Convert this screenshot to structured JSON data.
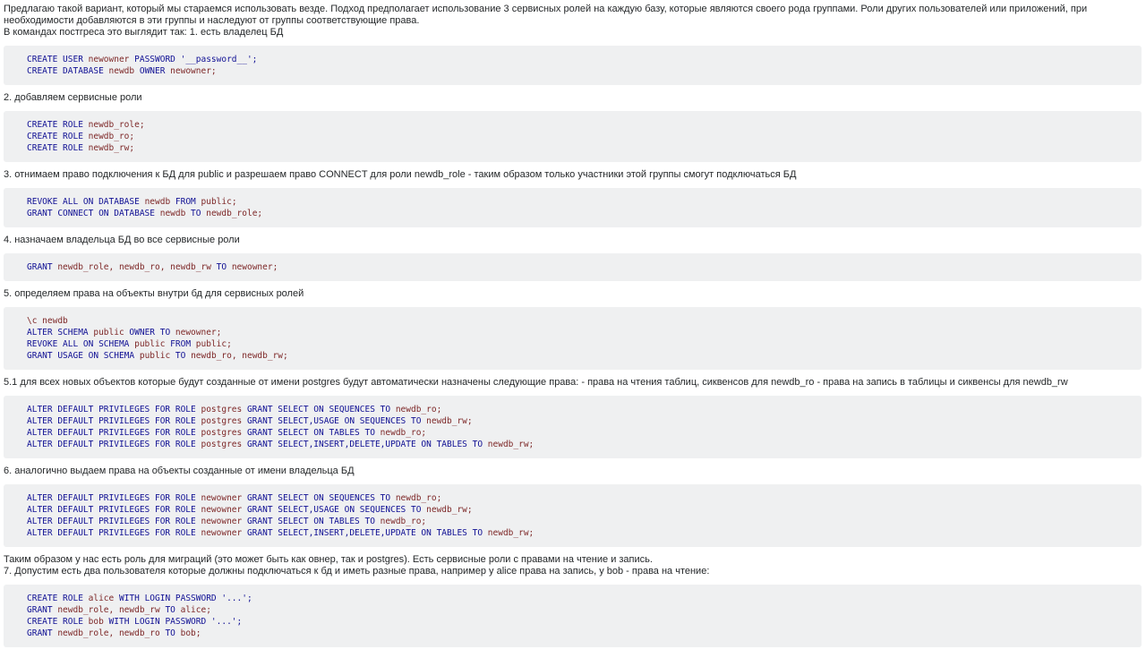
{
  "colors": {
    "page_bg": "#ffffff",
    "text": "#242729",
    "code_bg": "#eff0f1",
    "keyword": "#101094",
    "identifier": "#7d2727",
    "string": "#101094"
  },
  "content": {
    "blocks": [
      {
        "type": "p",
        "text": "Предлагаю такой вариант, который мы стараемся использовать везде. Подход предполагает использование 3 сервисных ролей на каждую базу, которые являются своего рода группами. Роли других пользователей или приложений, при необходимости добавляются в эти группы и наследуют от группы соответствующие права."
      },
      {
        "type": "p",
        "text": "В командах постгреса это выглядит так: 1. есть владелец БД"
      },
      {
        "type": "code",
        "lines": [
          [
            [
              "k",
              "CREATE USER "
            ],
            [
              "i",
              "newowner "
            ],
            [
              "k",
              "PASSWORD "
            ],
            [
              "s",
              "'__password__';"
            ]
          ],
          [
            [
              "k",
              "CREATE DATABASE "
            ],
            [
              "i",
              "newdb "
            ],
            [
              "k",
              "OWNER "
            ],
            [
              "i",
              "newowner;"
            ]
          ]
        ]
      },
      {
        "type": "p",
        "text": "2. добавляем сервисные роли"
      },
      {
        "type": "code",
        "lines": [
          [
            [
              "k",
              "CREATE ROLE "
            ],
            [
              "i",
              "newdb_role;"
            ]
          ],
          [
            [
              "k",
              "CREATE ROLE "
            ],
            [
              "i",
              "newdb_ro;"
            ]
          ],
          [
            [
              "k",
              "CREATE ROLE "
            ],
            [
              "i",
              "newdb_rw;"
            ]
          ]
        ]
      },
      {
        "type": "p",
        "text": "3. отнимаем право подключения к БД для public и разрешаем право CONNECT для роли newdb_role - таким образом только участники этой группы смогут подключаться БД"
      },
      {
        "type": "code",
        "lines": [
          [
            [
              "k",
              "REVOKE ALL ON DATABASE "
            ],
            [
              "i",
              "newdb "
            ],
            [
              "k",
              "FROM "
            ],
            [
              "i",
              "public;"
            ]
          ],
          [
            [
              "k",
              "GRANT CONNECT ON DATABASE "
            ],
            [
              "i",
              "newdb "
            ],
            [
              "k",
              "TO "
            ],
            [
              "i",
              "newdb_role;"
            ]
          ]
        ]
      },
      {
        "type": "p",
        "text": "4. назначаем владельца БД во все сервисные роли"
      },
      {
        "type": "code",
        "lines": [
          [
            [
              "k",
              "GRANT "
            ],
            [
              "i",
              "newdb_role, newdb_ro, newdb_rw "
            ],
            [
              "k",
              "TO "
            ],
            [
              "i",
              "newowner;"
            ]
          ]
        ]
      },
      {
        "type": "p",
        "text": "5. определяем права на объекты внутри бд для сервисных ролей"
      },
      {
        "type": "code",
        "lines": [
          [
            [
              "i",
              "\\c newdb"
            ]
          ],
          [
            [
              "k",
              "ALTER SCHEMA "
            ],
            [
              "i",
              "public "
            ],
            [
              "k",
              "OWNER TO "
            ],
            [
              "i",
              "newowner;"
            ]
          ],
          [
            [
              "k",
              "REVOKE ALL ON SCHEMA "
            ],
            [
              "i",
              "public "
            ],
            [
              "k",
              "FROM "
            ],
            [
              "i",
              "public;"
            ]
          ],
          [
            [
              "k",
              "GRANT USAGE ON SCHEMA "
            ],
            [
              "i",
              "public "
            ],
            [
              "k",
              "TO "
            ],
            [
              "i",
              "newdb_ro, newdb_rw;"
            ]
          ]
        ]
      },
      {
        "type": "p",
        "text": "5.1 для всех новых объектов которые будут созданные от имени postgres будут автоматически назначены следующие права: - права на чтения таблиц, сиквенсов для newdb_ro - права на запись в таблицы и сиквенсы для newdb_rw"
      },
      {
        "type": "code",
        "lines": [
          [
            [
              "k",
              "ALTER DEFAULT PRIVILEGES FOR ROLE "
            ],
            [
              "i",
              "postgres "
            ],
            [
              "k",
              "GRANT SELECT ON SEQUENCES TO "
            ],
            [
              "i",
              "newdb_ro;"
            ]
          ],
          [
            [
              "k",
              "ALTER DEFAULT PRIVILEGES FOR ROLE "
            ],
            [
              "i",
              "postgres "
            ],
            [
              "k",
              "GRANT SELECT,USAGE ON SEQUENCES TO "
            ],
            [
              "i",
              "newdb_rw;"
            ]
          ],
          [
            [
              "k",
              "ALTER DEFAULT PRIVILEGES FOR ROLE "
            ],
            [
              "i",
              "postgres "
            ],
            [
              "k",
              "GRANT SELECT ON TABLES TO "
            ],
            [
              "i",
              "newdb_ro;"
            ]
          ],
          [
            [
              "k",
              "ALTER DEFAULT PRIVILEGES FOR ROLE "
            ],
            [
              "i",
              "postgres "
            ],
            [
              "k",
              "GRANT SELECT,INSERT,DELETE,UPDATE ON TABLES TO "
            ],
            [
              "i",
              "newdb_rw;"
            ]
          ]
        ]
      },
      {
        "type": "p",
        "text": "6. аналогично выдаем права на объекты созданные от имени владельца БД"
      },
      {
        "type": "code",
        "lines": [
          [
            [
              "k",
              "ALTER DEFAULT PRIVILEGES FOR ROLE "
            ],
            [
              "i",
              "newowner "
            ],
            [
              "k",
              "GRANT SELECT ON SEQUENCES TO "
            ],
            [
              "i",
              "newdb_ro;"
            ]
          ],
          [
            [
              "k",
              "ALTER DEFAULT PRIVILEGES FOR ROLE "
            ],
            [
              "i",
              "newowner "
            ],
            [
              "k",
              "GRANT SELECT,USAGE ON SEQUENCES TO "
            ],
            [
              "i",
              "newdb_rw;"
            ]
          ],
          [
            [
              "k",
              "ALTER DEFAULT PRIVILEGES FOR ROLE "
            ],
            [
              "i",
              "newowner "
            ],
            [
              "k",
              "GRANT SELECT ON TABLES TO "
            ],
            [
              "i",
              "newdb_ro;"
            ]
          ],
          [
            [
              "k",
              "ALTER DEFAULT PRIVILEGES FOR ROLE "
            ],
            [
              "i",
              "newowner "
            ],
            [
              "k",
              "GRANT SELECT,INSERT,DELETE,UPDATE ON TABLES TO "
            ],
            [
              "i",
              "newdb_rw;"
            ]
          ]
        ]
      },
      {
        "type": "p",
        "text": "Таким образом у нас есть роль для миграций (это может быть как овнер, так и postgres). Есть сервисные роли с правами на чтение и запись."
      },
      {
        "type": "p",
        "text": "7. Допустим есть два пользователя которые должны подключаться к бд и иметь разные права, например у alice права на запись, у bob - права на чтение:"
      },
      {
        "type": "code",
        "lines": [
          [
            [
              "k",
              "CREATE ROLE "
            ],
            [
              "i",
              "alice "
            ],
            [
              "k",
              "WITH LOGIN PASSWORD "
            ],
            [
              "s",
              "'...';"
            ]
          ],
          [
            [
              "k",
              "GRANT "
            ],
            [
              "i",
              "newdb_role, newdb_rw "
            ],
            [
              "k",
              "TO "
            ],
            [
              "i",
              "alice;"
            ]
          ],
          [
            [
              "k",
              "CREATE ROLE "
            ],
            [
              "i",
              "bob "
            ],
            [
              "k",
              "WITH LOGIN PASSWORD "
            ],
            [
              "s",
              "'...';"
            ]
          ],
          [
            [
              "k",
              "GRANT "
            ],
            [
              "i",
              "newdb_role, newdb_ro "
            ],
            [
              "k",
              "TO "
            ],
            [
              "i",
              "bob;"
            ]
          ]
        ]
      }
    ]
  }
}
